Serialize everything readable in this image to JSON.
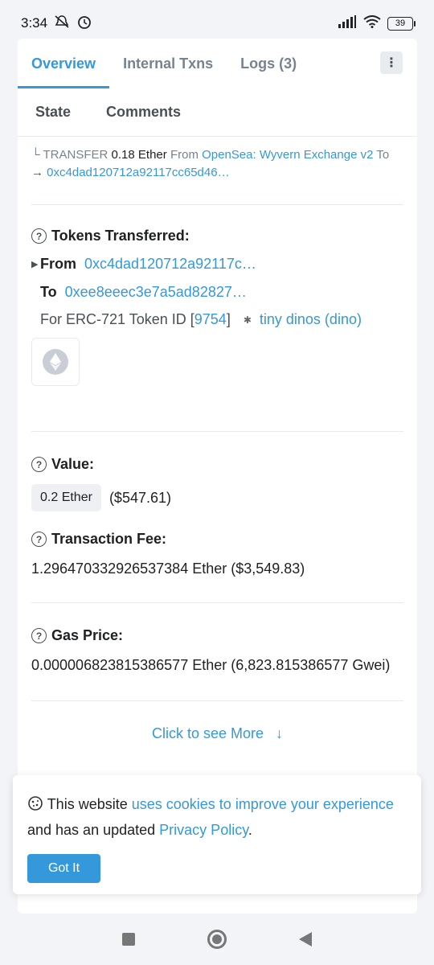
{
  "status_bar": {
    "time": "3:34",
    "battery": "39"
  },
  "tabs": {
    "overview": "Overview",
    "internal": "Internal Txns",
    "logs": "Logs (3)",
    "state": "State",
    "comments": "Comments",
    "more": "⋮"
  },
  "trace": {
    "prefix": "└ TRANSFER",
    "amount": "0.18 Ether",
    "from_word": "From",
    "from_link": "OpenSea: Wyvern Exchange v2",
    "to_word": "To",
    "arrow": "→",
    "to_link": "0xc4dad120712a92117cc65d46…"
  },
  "tokens": {
    "label": "Tokens Transferred:",
    "from_label": "From",
    "from_addr": "0xc4dad120712a92117c…",
    "to_label": "To",
    "to_addr": "0xee8eeec3e7a5ad82827…",
    "for_label": "For",
    "standard": "ERC-721 Token ID [",
    "token_id": "9754",
    "close_bracket": "]",
    "collection": "tiny dinos (dino)"
  },
  "value": {
    "label": "Value:",
    "amount": "0.2 Ether",
    "usd": "($547.61)"
  },
  "fee": {
    "label": "Transaction Fee:",
    "text": "1.296470332926537384 Ether ($3,549.83)"
  },
  "gas": {
    "label": "Gas Price:",
    "text": "0.000006823815386577 Ether (6,823.815386577 Gwei)"
  },
  "more_link": "Click to see More",
  "cookie": {
    "t1": "This website",
    "l1": "uses cookies to improve your experience",
    "t2": "and has an updated",
    "l2": "Privacy Policy",
    "t3": ".",
    "button": "Got It"
  },
  "colors": {
    "accent": "#3498db",
    "text": "#1e2022",
    "muted": "#77838f"
  }
}
